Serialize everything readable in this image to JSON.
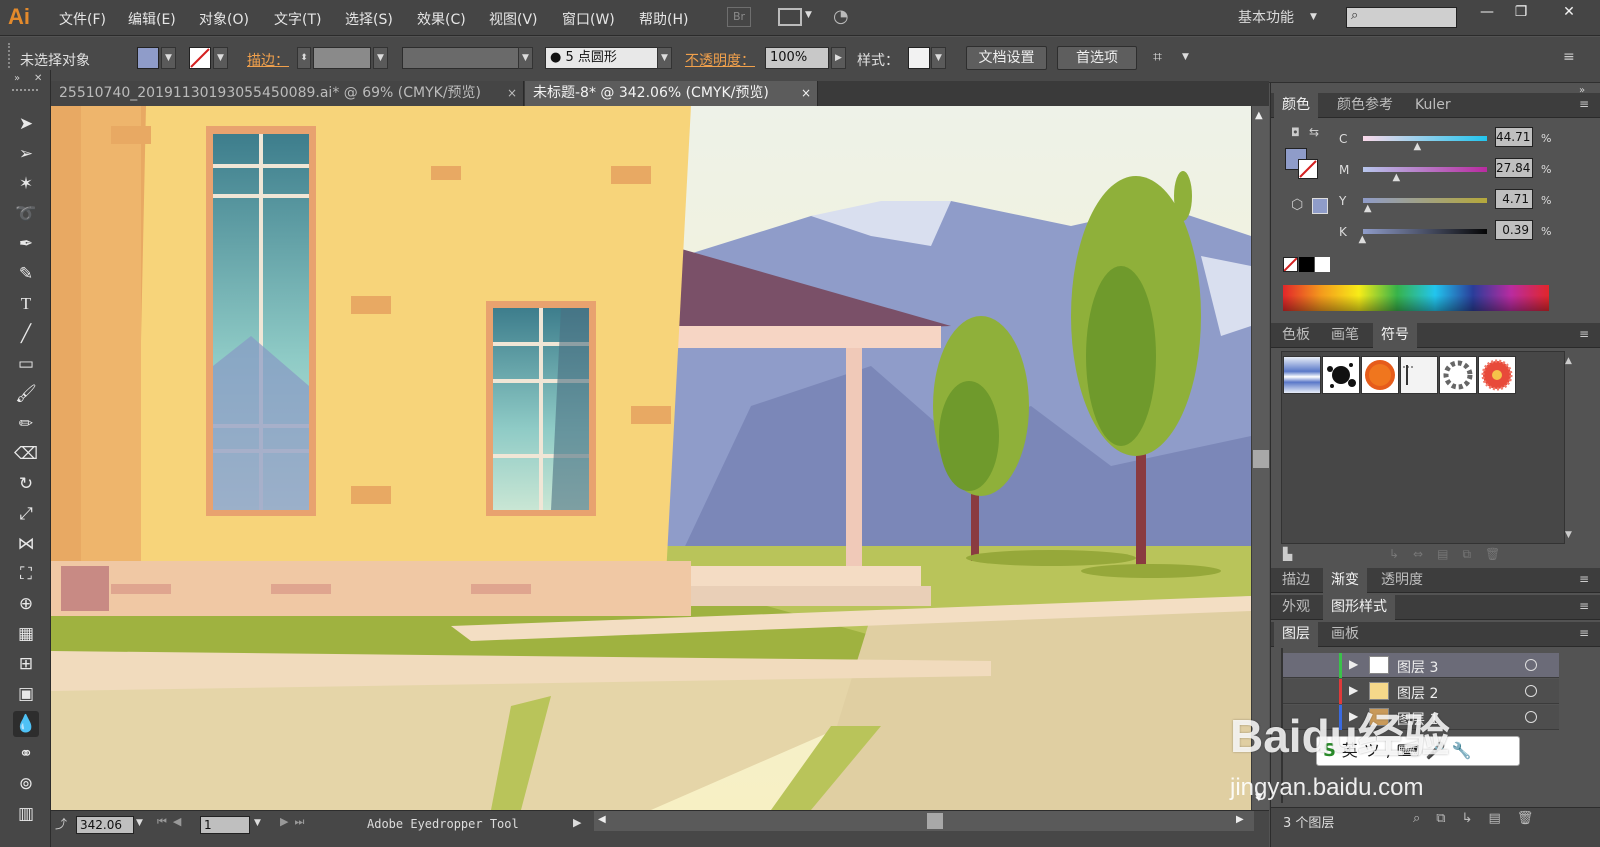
{
  "app": {
    "logo": "Ai"
  },
  "menu": [
    "文件(F)",
    "编辑(E)",
    "对象(O)",
    "文字(T)",
    "选择(S)",
    "效果(C)",
    "视图(V)",
    "窗口(W)",
    "帮助(H)"
  ],
  "bridge_label": "Br",
  "workspace_label": "基本功能",
  "control": {
    "selection_status": "未选择对象",
    "stroke_label": "描边：",
    "brush_label": "5 点圆形",
    "opacity_label": "不透明度：",
    "opacity_value": "100%",
    "style_label": "样式：",
    "doc_setup_button": "文档设置",
    "preferences_button": "首选项"
  },
  "tabs": [
    {
      "label": "25510740_20191130193055450089.ai* @ 69% (CMYK/预览)",
      "close": "×"
    },
    {
      "label": "未标题-8* @ 342.06% (CMYK/预览)",
      "close": "×"
    }
  ],
  "status": {
    "zoom": "342.06",
    "artboard": "1",
    "tool_name": "Adobe Eyedropper Tool"
  },
  "color_panel": {
    "tabs": [
      "颜色",
      "颜色参考",
      "Kuler"
    ],
    "channels": [
      {
        "name": "C",
        "value": "44.71",
        "fraction": 0.4471
      },
      {
        "name": "M",
        "value": "27.84",
        "fraction": 0.2784
      },
      {
        "name": "Y",
        "value": "4.71",
        "fraction": 0.0471
      },
      {
        "name": "K",
        "value": "0.39",
        "fraction": 0.0039
      }
    ],
    "pct": "%",
    "fill_color": "#8f9cc9"
  },
  "swatch_panel": {
    "tabs": [
      "色板",
      "画笔",
      "符号"
    ]
  },
  "appearance_tabs": [
    "描边",
    "渐变",
    "透明度"
  ],
  "style_tabs": [
    "外观",
    "图形样式"
  ],
  "layers_panel": {
    "tabs": [
      "图层",
      "画板"
    ],
    "layers": [
      {
        "name": "图层 3"
      },
      {
        "name": "图层 2"
      },
      {
        "name": "图层 1"
      }
    ],
    "count_label": "3 个图层"
  },
  "watermark": {
    "text": "Baidu经验",
    "url": "jingyan.baidu.com"
  }
}
